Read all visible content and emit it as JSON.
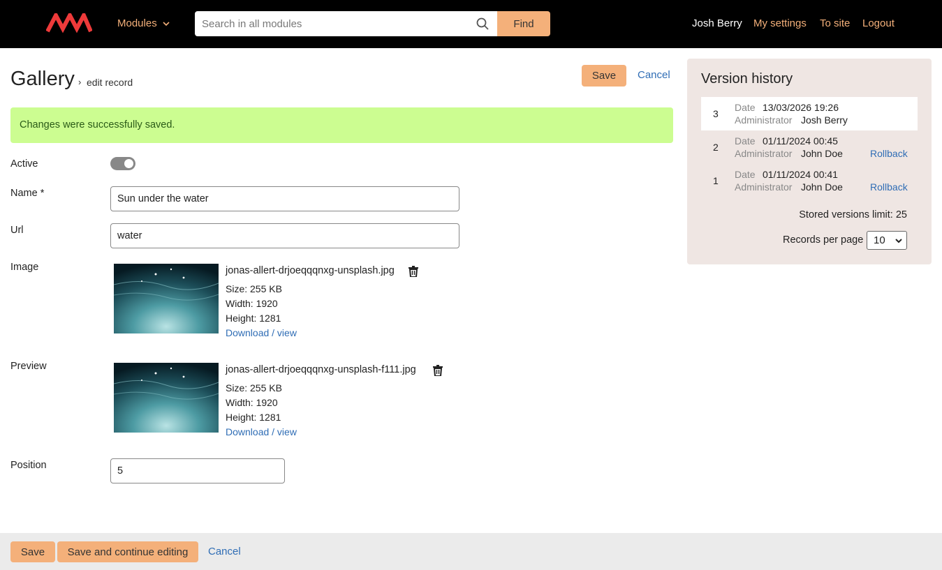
{
  "header": {
    "modules_label": "Modules",
    "search_placeholder": "Search in all modules",
    "find_label": "Find",
    "user_name": "Josh Berry",
    "my_settings": "My settings",
    "to_site": "To site",
    "logout": "Logout",
    "accent_color": "#f4b07a",
    "logo_color": "#ee3a3a"
  },
  "page": {
    "title": "Gallery",
    "breadcrumb_sep": "›",
    "breadcrumb": "edit record",
    "save_label": "Save",
    "cancel_label": "Cancel",
    "alert": "Changes were successfully saved."
  },
  "form": {
    "active_label": "Active",
    "active_value": true,
    "name_label": "Name",
    "name_required_mark": "*",
    "name_value": "Sun under the water",
    "url_label": "Url",
    "url_value": "water",
    "image_label": "Image",
    "image": {
      "file_name": "jonas-allert-drjoeqqqnxg-unsplash.jpg",
      "size": "Size: 255 KB",
      "width": "Width: 1920",
      "height": "Height: 1281",
      "download": "Download / view"
    },
    "preview_label": "Preview",
    "preview": {
      "file_name": "jonas-allert-drjoeqqqnxg-unsplash-f111.jpg",
      "size": "Size: 255 KB",
      "width": "Width: 1920",
      "height": "Height: 1281",
      "download": "Download / view"
    },
    "position_label": "Position",
    "position_value": "5"
  },
  "version_history": {
    "title": "Version history",
    "rows": [
      {
        "num": "3",
        "date_label": "Date",
        "date": "13/03/2026 19:26",
        "admin_label": "Administrator",
        "admin": "Josh Berry",
        "rollback": ""
      },
      {
        "num": "2",
        "date_label": "Date",
        "date": "01/11/2024 00:45",
        "admin_label": "Administrator",
        "admin": "John Doe",
        "rollback": "Rollback"
      },
      {
        "num": "1",
        "date_label": "Date",
        "date": "01/11/2024 00:41",
        "admin_label": "Administrator",
        "admin": "John Doe",
        "rollback": "Rollback"
      }
    ],
    "limit_text": "Stored versions limit: 25",
    "rpp_label": "Records per page",
    "rpp_value": "10"
  },
  "footer": {
    "save_label": "Save",
    "save_continue_label": "Save and continue editing",
    "cancel_label": "Cancel"
  }
}
